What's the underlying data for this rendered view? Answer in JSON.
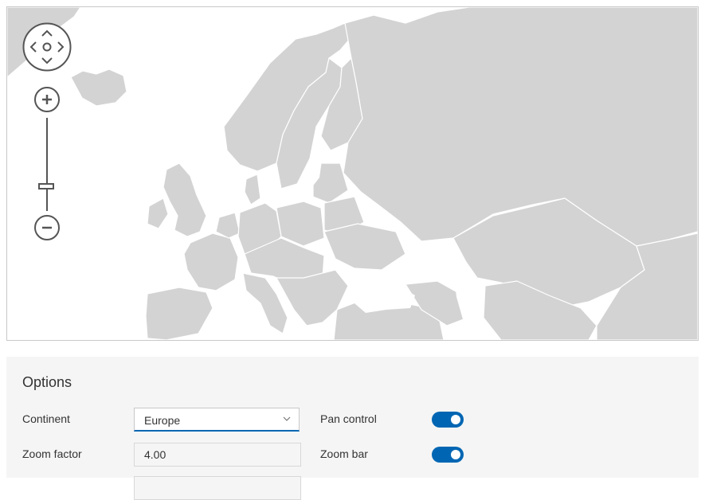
{
  "map": {
    "land_color": "#d3d3d3",
    "border_color": "#ffffff",
    "controls": {
      "pan_icon": "pan-arrows-icon",
      "zoom_in_icon": "plus-circle-icon",
      "zoom_out_icon": "minus-circle-icon",
      "zoom_level_fraction": 0.25
    }
  },
  "options": {
    "title": "Options",
    "continent_label": "Continent",
    "continent_value": "Europe",
    "zoom_factor_label": "Zoom factor",
    "zoom_factor_value": "4.00",
    "pan_control_label": "Pan control",
    "pan_control_on": true,
    "zoom_bar_label": "Zoom bar",
    "zoom_bar_on": true,
    "accent_color": "#0066b3"
  }
}
